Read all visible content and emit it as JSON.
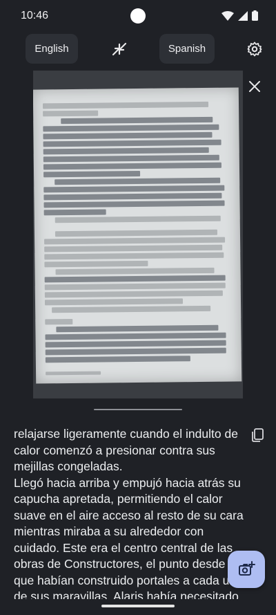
{
  "status": {
    "time": "10:46"
  },
  "toolbar": {
    "source_language": "English",
    "target_language": "Spanish",
    "swap_icon": "swap-languages-icon",
    "settings_icon": "gear-icon"
  },
  "image_panel": {
    "close_icon": "close-icon"
  },
  "result": {
    "text": "relajarse ligeramente cuando el indulto de calor comenzó a presionar contra sus mejillas congeladas.\nLlegó hacia arriba y empujó hacia atrás su capucha apretada, permitiendo el calor suave en el aire acceso al resto de su cara mientras miraba a su alrededor con cuidado. Este era el centro central de las obras de Constructores, el punto desde el que habían construido portales a cada una de sus maravillas. Alaris había necesitado",
    "copy_icon": "copy-icon"
  },
  "fab": {
    "icon": "add-photo-icon"
  },
  "colors": {
    "background": "#1f2126",
    "button": "#2d3036",
    "fab": "#aebdf2"
  }
}
